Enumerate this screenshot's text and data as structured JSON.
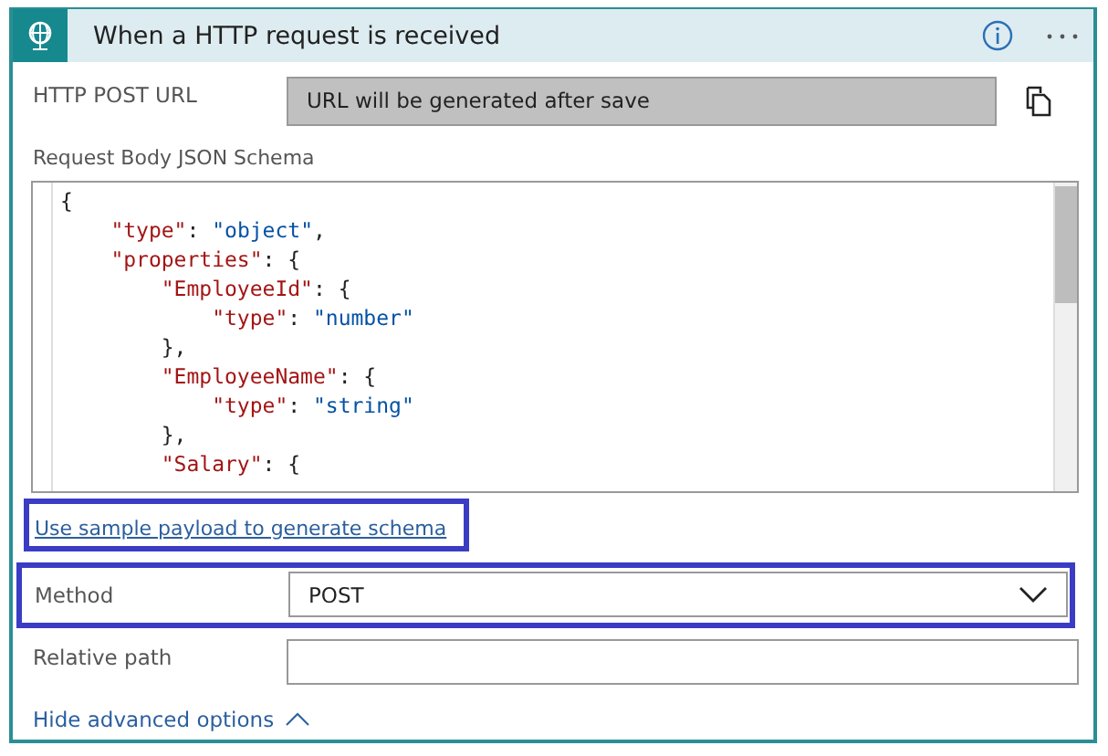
{
  "header": {
    "title": "When a HTTP request is received"
  },
  "url_field": {
    "label": "HTTP POST URL",
    "value": "URL will be generated after save"
  },
  "schema": {
    "label": "Request Body JSON Schema",
    "lines": [
      {
        "tokens": [
          {
            "kind": "punct",
            "text": "{"
          }
        ]
      },
      {
        "tokens": [
          {
            "kind": "key",
            "text": "    \"type\""
          },
          {
            "kind": "punct",
            "text": ": "
          },
          {
            "kind": "string",
            "text": "\"object\""
          },
          {
            "kind": "punct",
            "text": ","
          }
        ]
      },
      {
        "tokens": [
          {
            "kind": "key",
            "text": "    \"properties\""
          },
          {
            "kind": "punct",
            "text": ": {"
          }
        ]
      },
      {
        "tokens": [
          {
            "kind": "key",
            "text": "        \"EmployeeId\""
          },
          {
            "kind": "punct",
            "text": ": {"
          }
        ]
      },
      {
        "tokens": [
          {
            "kind": "key",
            "text": "            \"type\""
          },
          {
            "kind": "punct",
            "text": ": "
          },
          {
            "kind": "string",
            "text": "\"number\""
          }
        ]
      },
      {
        "tokens": [
          {
            "kind": "punct",
            "text": "        },"
          }
        ]
      },
      {
        "tokens": [
          {
            "kind": "key",
            "text": "        \"EmployeeName\""
          },
          {
            "kind": "punct",
            "text": ": {"
          }
        ]
      },
      {
        "tokens": [
          {
            "kind": "key",
            "text": "            \"type\""
          },
          {
            "kind": "punct",
            "text": ": "
          },
          {
            "kind": "string",
            "text": "\"string\""
          }
        ]
      },
      {
        "tokens": [
          {
            "kind": "punct",
            "text": "        },"
          }
        ]
      },
      {
        "tokens": [
          {
            "kind": "key",
            "text": "        \"Salary\""
          },
          {
            "kind": "punct",
            "text": ": {"
          }
        ]
      }
    ]
  },
  "sample_link": {
    "text": "Use sample payload to generate schema",
    "highlighted": true
  },
  "method": {
    "label": "Method",
    "value": "POST",
    "highlighted": true
  },
  "relative_path": {
    "label": "Relative path"
  },
  "advanced_toggle": {
    "text": "Hide advanced options",
    "expanded": true
  }
}
